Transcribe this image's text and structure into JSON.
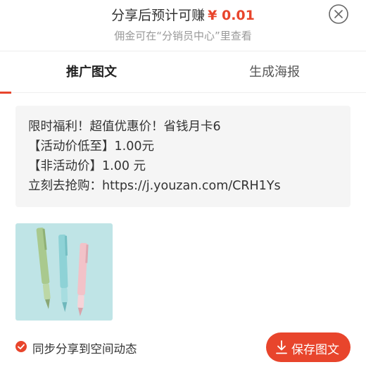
{
  "header": {
    "earn_text": "分享后预计可赚",
    "earn_amount": "¥ 0.01",
    "commission_note": "佣金可在“分销员中心”里查看",
    "close_icon": "close-circle-icon"
  },
  "tabs": [
    {
      "label": "推广图文",
      "active": true
    },
    {
      "label": "生成海报",
      "active": false
    }
  ],
  "promo_text": {
    "lines": [
      "限时福利！超值优惠价！省钱月卡6",
      "【活动价低至】1.00元",
      "【非活动价】1.00 元",
      "立刻去抢购：https://j.youzan.com/CRH1Ys"
    ]
  },
  "product_image": {
    "description_icon": "pens-product-image",
    "pen_colors": [
      "#a9c98e",
      "#8ed2d6",
      "#f2c2c8"
    ],
    "background": "#bfe4e6"
  },
  "footer": {
    "sync_label": "同步分享到空间动态",
    "sync_checked": true,
    "save_label": "保存图文",
    "save_icon": "download-icon"
  },
  "colors": {
    "accent": "#e8452c"
  }
}
